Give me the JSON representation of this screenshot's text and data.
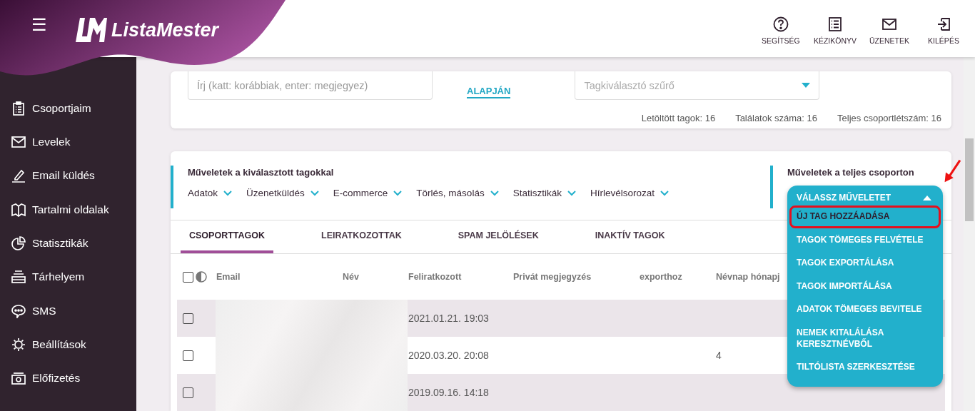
{
  "header": {
    "brand": "ListaMester",
    "menu_icon": "☰",
    "actions": [
      {
        "label": "SEGÍTSÉG",
        "kind": "help"
      },
      {
        "label": "KÉZIKÖNYV",
        "kind": "manual"
      },
      {
        "label": "ÜZENETEK",
        "kind": "mail"
      },
      {
        "label": "KILÉPÉS",
        "kind": "logout"
      }
    ]
  },
  "sidebar": {
    "items": [
      {
        "label": "Csoportjaim",
        "kind": "clipboard"
      },
      {
        "label": "Levelek",
        "kind": "mail"
      },
      {
        "label": "Email küldés",
        "kind": "pen"
      },
      {
        "label": "Tartalmi oldalak",
        "kind": "book"
      },
      {
        "label": "Statisztikák",
        "kind": "pie"
      },
      {
        "label": "Tárhelyem",
        "kind": "storage"
      },
      {
        "label": "SMS",
        "kind": "chat"
      },
      {
        "label": "Beállítások",
        "kind": "gear"
      },
      {
        "label": "Előfizetés",
        "kind": "money"
      }
    ]
  },
  "filter_card": {
    "search": {
      "placeholder": "Írj (katt: korábbiak, enter: megjegyez)"
    },
    "link": "ALAPJÁN",
    "filter": {
      "placeholder": "Tagkiválasztó szűrő"
    },
    "stats": [
      "Letöltött tagok: 16",
      "Találatok száma: 16",
      "Teljes csoportlétszám: 16"
    ]
  },
  "selected_actions": {
    "title": "Műveletek a kiválasztott tagokkal",
    "menus": [
      "Adatok",
      "Üzenetküldés",
      "E-commerce",
      "Törlés, másolás",
      "Statisztikák",
      "Hírlevélsorozat"
    ]
  },
  "group_actions": {
    "title": "Műveletek a teljes csoporton",
    "dropdown": {
      "label": "VÁLASSZ MŰVELETET",
      "expanded": true,
      "options": [
        {
          "label": "ÚJ TAG HOZZÁADÁSA",
          "highlighted": true
        },
        {
          "label": "TAGOK TÖMEGES FELVÉTELE",
          "highlighted": false
        },
        {
          "label": "TAGOK EXPORTÁLÁSA",
          "highlighted": false
        },
        {
          "label": "TAGOK IMPORTÁLÁSA",
          "highlighted": false
        },
        {
          "label": "ADATOK TÖMEGES BEVITELE",
          "highlighted": false
        },
        {
          "label": "NEMEK KITALÁLÁSA KERESZTNÉVBŐL",
          "highlighted": false
        },
        {
          "label": "TILTÓLISTA SZERKESZTÉSE",
          "highlighted": false
        }
      ]
    }
  },
  "tabs": [
    {
      "label": "CSOPORTTAGOK",
      "selected": true
    },
    {
      "label": "LEIRATKOZOTTAK",
      "selected": false
    },
    {
      "label": "SPAM JELÖLÉSEK",
      "selected": false
    },
    {
      "label": "INAKTÍV TAGOK",
      "selected": false
    }
  ],
  "table": {
    "select_all": {
      "checked": false
    },
    "columns": [
      "Email",
      "Név",
      "Feliratkozott",
      "Privát megjegyzés",
      "exporthoz",
      "Névnap hónapj"
    ],
    "rows": [
      {
        "checked": false,
        "subscribed": "2021.01.21. 19:03",
        "note": "",
        "export": "",
        "nameday_month": ""
      },
      {
        "checked": false,
        "subscribed": "2020.03.20. 20:08",
        "note": "",
        "export": "",
        "nameday_month": "4"
      },
      {
        "checked": false,
        "subscribed": "2019.09.16. 14:18",
        "note": "",
        "export": "",
        "nameday_month": ""
      }
    ]
  }
}
